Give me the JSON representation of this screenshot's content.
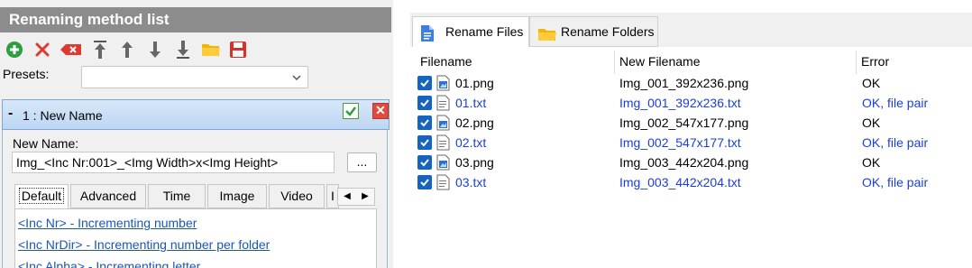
{
  "left_panel": {
    "title": "Renaming method list",
    "toolbar": [
      "add-icon",
      "delete-icon",
      "clear-icon",
      "move-top-icon",
      "move-up-icon",
      "move-down-icon",
      "move-bottom-icon",
      "open-folder-icon",
      "save-icon"
    ],
    "presets_label": "Presets:",
    "presets_value": "",
    "method": {
      "title": "1 : New Name",
      "enabled": true,
      "new_name_label": "New Name:",
      "new_name_value": "Img_<Inc Nr:001>_<Img Width>x<Img Height>",
      "browse_label": "...",
      "tabs": [
        "Default",
        "Advanced",
        "Time",
        "Image",
        "Video",
        "I"
      ],
      "active_tab": "Default",
      "links": [
        "<Inc Nr> - Incrementing number",
        "<Inc NrDir> - Incrementing number per folder",
        "<Inc Alpha> - Incrementing letter"
      ]
    }
  },
  "right_panel": {
    "tabs": [
      {
        "label": "Rename Files",
        "active": true
      },
      {
        "label": "Rename Folders",
        "active": false
      }
    ],
    "columns": [
      "Filename",
      "New Filename",
      "Error"
    ],
    "rows": [
      {
        "filename": "01.png",
        "new_filename": "Img_001_392x236.png",
        "error": "OK",
        "checked": true,
        "type": "image",
        "highlight": false
      },
      {
        "filename": "01.txt",
        "new_filename": "Img_001_392x236.txt",
        "error": "OK, file pair",
        "checked": true,
        "type": "text",
        "highlight": true
      },
      {
        "filename": "02.png",
        "new_filename": "Img_002_547x177.png",
        "error": "OK",
        "checked": true,
        "type": "image",
        "highlight": false
      },
      {
        "filename": "02.txt",
        "new_filename": "Img_002_547x177.txt",
        "error": "OK, file pair",
        "checked": true,
        "type": "text",
        "highlight": true
      },
      {
        "filename": "03.png",
        "new_filename": "Img_003_442x204.png",
        "error": "OK",
        "checked": true,
        "type": "image",
        "highlight": false
      },
      {
        "filename": "03.txt",
        "new_filename": "Img_003_442x204.txt",
        "error": "OK, file pair",
        "checked": true,
        "type": "text",
        "highlight": true
      }
    ]
  },
  "colors": {
    "title_bar": "#8c8c8c",
    "link": "#1a56b8",
    "pair_text": "#1a3fd6",
    "checkbox": "#1565c0"
  }
}
